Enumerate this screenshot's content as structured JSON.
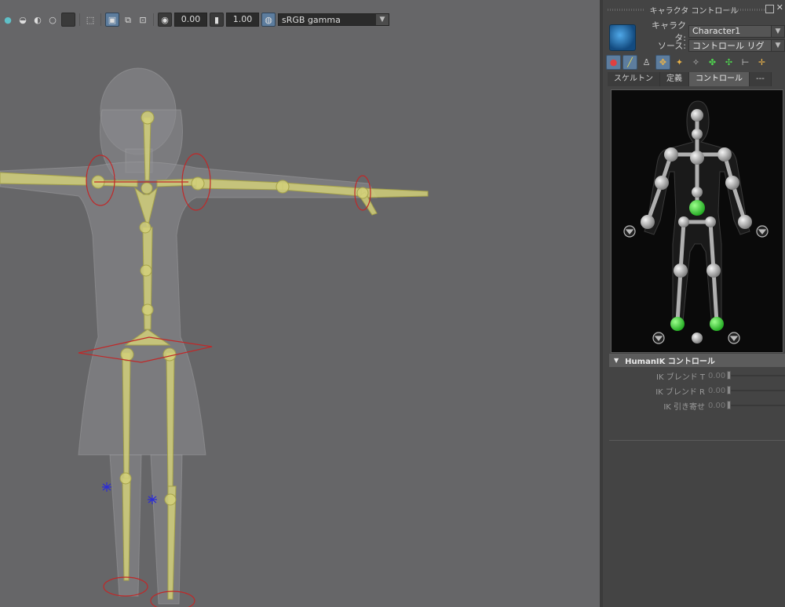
{
  "viewport": {
    "toolbar": {
      "exposure_value": "0.00",
      "gamma_value": "1.00",
      "color_space": "sRGB gamma",
      "accent_color": "#5d7d9e"
    }
  },
  "panel": {
    "title": "キャラクタ コントロール",
    "character": {
      "label": "キャラクタ:",
      "value": "Character1"
    },
    "source": {
      "label": "ソース:",
      "value": "コントロール リグ"
    },
    "tabs": [
      {
        "label": "スケルトン",
        "active": false
      },
      {
        "label": "定義",
        "active": false
      },
      {
        "label": "コントロール",
        "active": true
      },
      {
        "label": "---",
        "active": false
      }
    ],
    "section": {
      "title": "HumanIK コントロール",
      "rows": [
        {
          "label": "IK ブレンド T",
          "value": "0.00"
        },
        {
          "label": "IK ブレンド R",
          "value": "0.00"
        },
        {
          "label": "IK 引き寄せ",
          "value": "0.00"
        }
      ]
    },
    "colors": {
      "active_effector": "#2fd42f",
      "joint": "#b8b8b8",
      "skeleton_bg": "#0a0a0a"
    }
  }
}
